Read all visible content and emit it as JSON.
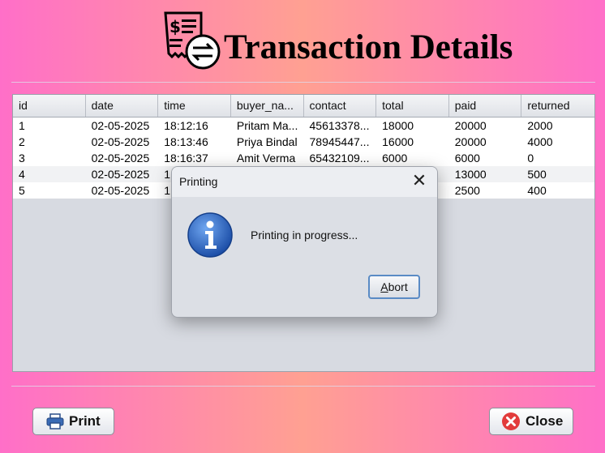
{
  "header": {
    "title": "Transaction Details",
    "logo_icon": "receipt-transfer-icon"
  },
  "table": {
    "columns": [
      "id",
      "date",
      "time",
      "buyer_na...",
      "contact",
      "total",
      "paid",
      "returned"
    ],
    "rows": [
      [
        "1",
        "02-05-2025",
        "18:12:16",
        "Pritam Ma...",
        "45613378...",
        "18000",
        "20000",
        "2000"
      ],
      [
        "2",
        "02-05-2025",
        "18:13:46",
        "Priya Bindal",
        "78945447...",
        "16000",
        "20000",
        "4000"
      ],
      [
        "3",
        "02-05-2025",
        "18:16:37",
        "Amit Verma",
        "65432109...",
        "6000",
        "6000",
        "0"
      ],
      [
        "4",
        "02-05-2025",
        "1",
        "",
        "",
        "",
        "13000",
        "500"
      ],
      [
        "5",
        "02-05-2025",
        "1",
        "",
        "",
        "",
        "2500",
        "400"
      ]
    ]
  },
  "dialog": {
    "title": "Printing",
    "message": "Printing in progress...",
    "abort_mnemonic": "A",
    "abort_rest": "bort",
    "icon": "info-icon",
    "close_icon": "close-icon"
  },
  "buttons": {
    "print": "Print",
    "close": "Close"
  },
  "colors": {
    "bg_pink": "#ff6fc8",
    "bg_peach": "#ffa092",
    "info_blue": "#2a62c0",
    "close_red": "#e23b3b"
  }
}
